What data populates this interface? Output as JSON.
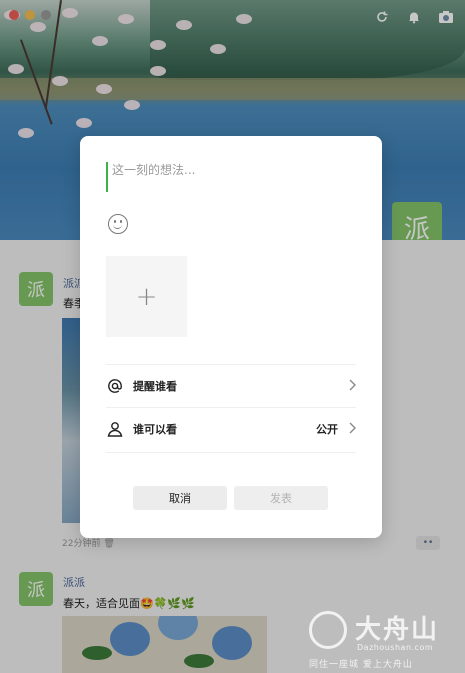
{
  "window": {
    "traffic_lights": [
      "#ee5f56",
      "#f4be4f",
      "#9a9a9a"
    ]
  },
  "header_icons": [
    "refresh-icon",
    "bell-icon",
    "camera-icon"
  ],
  "profile": {
    "avatar_text": "派"
  },
  "feed": {
    "posts": [
      {
        "avatar_text": "派",
        "name": "派派",
        "text": "春季",
        "time": "22分钟前",
        "more": "••"
      },
      {
        "avatar_text": "派",
        "name": "派派",
        "text": "春天，适合见面🤩🍀🌿🌿"
      }
    ]
  },
  "dialog": {
    "placeholder": "这一刻的想法...",
    "emoji_icon": "smiley-icon",
    "add_photo": "+",
    "remind_label": "提醒谁看",
    "visibility_label": "谁可以看",
    "visibility_value": "公开",
    "cancel_label": "取消",
    "post_label": "发表"
  },
  "watermark": {
    "title": "大舟山",
    "url": "Dazhoushan.com",
    "slogan": "同住一座城 爱上大舟山"
  },
  "colors": {
    "accent_green": "#3ab54a",
    "avatar_green": "#84c46a",
    "name_blue": "#4a6697"
  }
}
